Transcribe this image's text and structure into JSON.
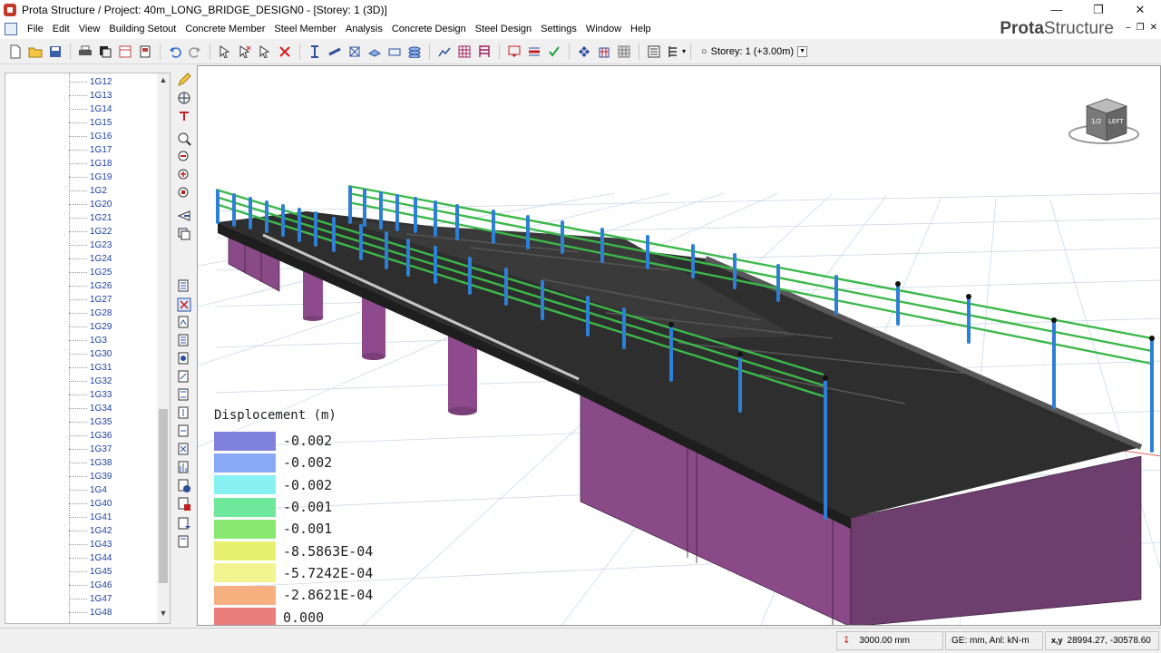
{
  "window": {
    "title": "Prota Structure / Project: 40m_LONG_BRIDGE_DESIGN0 - [Storey: 1 (3D)]",
    "minimize": "—",
    "restore": "❐",
    "close": "✕"
  },
  "menubar": {
    "items": [
      "File",
      "Edit",
      "View",
      "Building Setout",
      "Concrete Member",
      "Steel Member",
      "Analysis",
      "Concrete Design",
      "Steel Design",
      "Settings",
      "Window",
      "Help"
    ],
    "brand_bold": "Prota",
    "brand_rest": "Structure",
    "mdi_controls": [
      "–",
      "❐",
      "✕"
    ]
  },
  "toolbar": {
    "storey_label": "Storey: 1 (+3.00m)"
  },
  "tree": {
    "items": [
      "1G12",
      "1G13",
      "1G14",
      "1G15",
      "1G16",
      "1G17",
      "1G18",
      "1G19",
      "1G2",
      "1G20",
      "1G21",
      "1G22",
      "1G23",
      "1G24",
      "1G25",
      "1G26",
      "1G27",
      "1G28",
      "1G29",
      "1G3",
      "1G30",
      "1G31",
      "1G32",
      "1G33",
      "1G34",
      "1G35",
      "1G36",
      "1G37",
      "1G38",
      "1G39",
      "1G4",
      "1G40",
      "1G41",
      "1G42",
      "1G43",
      "1G44",
      "1G45",
      "1G46",
      "1G47",
      "1G48"
    ]
  },
  "viewcube": {
    "face_label": "LEFT",
    "side_label": "1/2"
  },
  "legend": {
    "title": "Displocement (m)",
    "entries": [
      {
        "value": "-0.002",
        "color": "#8080dd"
      },
      {
        "value": "-0.002",
        "color": "#88aaf5"
      },
      {
        "value": "-0.002",
        "color": "#88f2f2"
      },
      {
        "value": "-0.001",
        "color": "#6ee89a"
      },
      {
        "value": "-0.001",
        "color": "#88e870"
      },
      {
        "value": "-8.5863E-04",
        "color": "#e8f070"
      },
      {
        "value": "-5.7242E-04",
        "color": "#f2f490"
      },
      {
        "value": "-2.8621E-04",
        "color": "#f6b080"
      },
      {
        "value": "0.000",
        "color": "#ec7d7d"
      }
    ]
  },
  "statusbar": {
    "elevation": "3000.00 mm",
    "units": "GE: mm,  Anl: kN-m",
    "coords_label": "x,y",
    "coords": "28994.27, -30578.60"
  },
  "colors": {
    "deck": "#2e2e2e",
    "pier": "#8e4a8c",
    "abutment": "#6e3f6e",
    "post": "#2e7fd6",
    "rail": "#3cb84a",
    "grid": "#b8cfe4"
  }
}
